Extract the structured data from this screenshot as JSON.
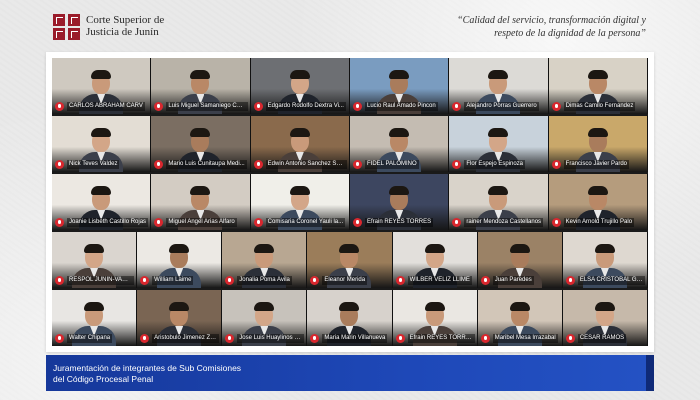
{
  "header": {
    "org_line1": "Corte Superior de",
    "org_line2": "Justicia de Junín",
    "slogan_line1": "“Calidad del servicio, transformación digital y",
    "slogan_line2": "respeto de la dignidad de la persona”",
    "brand_color": "#9a1b2a"
  },
  "grid": {
    "rows": [
      [
        "CARLOS ABRAHAM CARV",
        "Luis Miguel Samaniego Cor...",
        "Edgardo Rodolfo Dextra Vi...",
        "Lucio Raul Amado Pincon",
        "Alejandro Porras Guerrero",
        "Dimas Camilo Fernandez"
      ],
      [
        "Nick Teves Valdez",
        "Mario Luis Cunitaupa Medi...",
        "Edwin Antonio Sanchez Sal...",
        "FIDEL PALOMINO",
        "Flor Espejo Espinoza",
        "Francisco Javier Pardo"
      ],
      [
        "Joanie Lisbeth Castillo Rojas",
        "Miguel Angel Arias Alfaro",
        "Comisaria Coronel Yauli la...",
        "Efrain REYES TORRES",
        "rainer Mendoza Castellanos",
        "Kevin Arnold Trujillo Palo"
      ],
      [
        "RESPOL JUNIN-VARGAS DE",
        "William Laime",
        "Jonalia Poma Avila",
        "Eleanor Merida",
        "WILBER VELIZ LLIME",
        "Juan Paredes",
        "ELSA CRISTOBAL GUE"
      ],
      [
        "Walter Chipana",
        "Aristobulo Jimenez Zegarra",
        "Jose Luis Huaylinos Rodrig...",
        "Maria Marin Villanueva",
        "Efrain REYES TORRES",
        "Maribel Mesa Irrazabal",
        "CESAR RAMOS"
      ]
    ]
  },
  "banner": {
    "line1": "Juramentación de integrantes de Sub Comisiones",
    "line2": "del Código Procesal Penal"
  }
}
